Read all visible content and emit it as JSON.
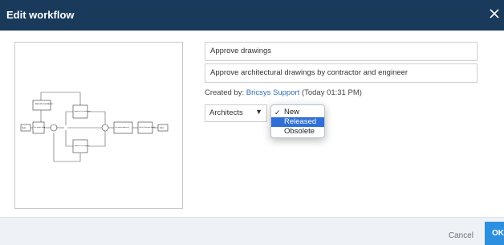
{
  "dialog": {
    "title": "Edit workflow",
    "close_icon": "close-icon"
  },
  "workflow": {
    "name": "Approve drawings",
    "description": "Approve architectural drawings by contractor and engineer",
    "created_label": "Created by:",
    "created_by": "Bricsys Support",
    "created_time": "(Today 01:31 PM)"
  },
  "group_select": {
    "value": "Architects",
    "arrow_icon": "dropdown-arrow-icon"
  },
  "status_dropdown": {
    "options": [
      {
        "label": "New",
        "checked": true
      },
      {
        "label": "Released",
        "highlighted": true
      },
      {
        "label": "Obsolete"
      }
    ],
    "check_icon": "checkmark-icon"
  },
  "diagram": {
    "nodes": {
      "rework": "Rework documents",
      "approve_contractor": "Approve by contractor",
      "approve_engineer": "Approve by engineer",
      "set_status_draft": "Set status draft",
      "set_status_approved": "Set status approved",
      "add_to_drawings": "Add to Drawings bundle",
      "start": "Start",
      "end": "End"
    }
  },
  "footer": {
    "cancel_label": "Cancel",
    "ok_label": "OK"
  },
  "colors": {
    "titlebar": "#1a3a5c",
    "link": "#2f6db5",
    "selection": "#2f6fd6",
    "ok_button": "#2d8fe0"
  }
}
